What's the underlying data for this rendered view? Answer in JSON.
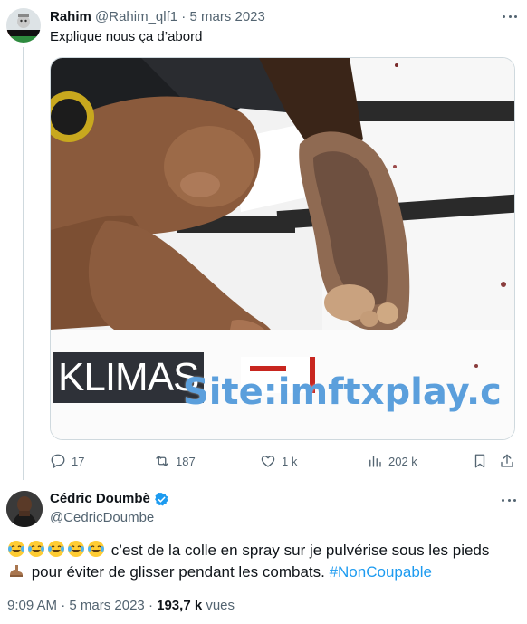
{
  "tweet1": {
    "author_name": "Rahim",
    "handle": "@Rahim_qlf1",
    "separator": " · ",
    "date": "5 mars 2023",
    "text": "Explique nous ça d’abord",
    "media": {
      "overlay_name": "KLIMAS",
      "watermark": "Site:imftxplay.c"
    },
    "actions": {
      "replies": "17",
      "retweets": "187",
      "likes": "1 k",
      "views": "202 k"
    }
  },
  "tweet2": {
    "author_name": "Cédric Doumbè",
    "handle": "@CedricDoumbe",
    "emojis_line1": [
      "face-with-tears-of-joy",
      "face-with-tears-of-joy",
      "face-with-tears-of-joy",
      "face-with-tears-of-joy",
      "face-with-tears-of-joy"
    ],
    "text_line1": " c’est de la colle en spray sur je pulvérise sous les pieds",
    "emoji_line2": "foot",
    "text_line2": " pour éviter de glisser pendant les combats. ",
    "hashtag": "#NonCoupable",
    "time": "9:09 AM",
    "separator": " · ",
    "date": "5 mars 2023",
    "views_count": "193,7 k",
    "views_label": " vues"
  },
  "colors": {
    "text_primary": "#0f1419",
    "text_secondary": "#536471",
    "link": "#1d9bf0",
    "thread_line": "#cfd9de",
    "watermark": "#5b9fdc",
    "overlay_bar": "#2e3138"
  }
}
